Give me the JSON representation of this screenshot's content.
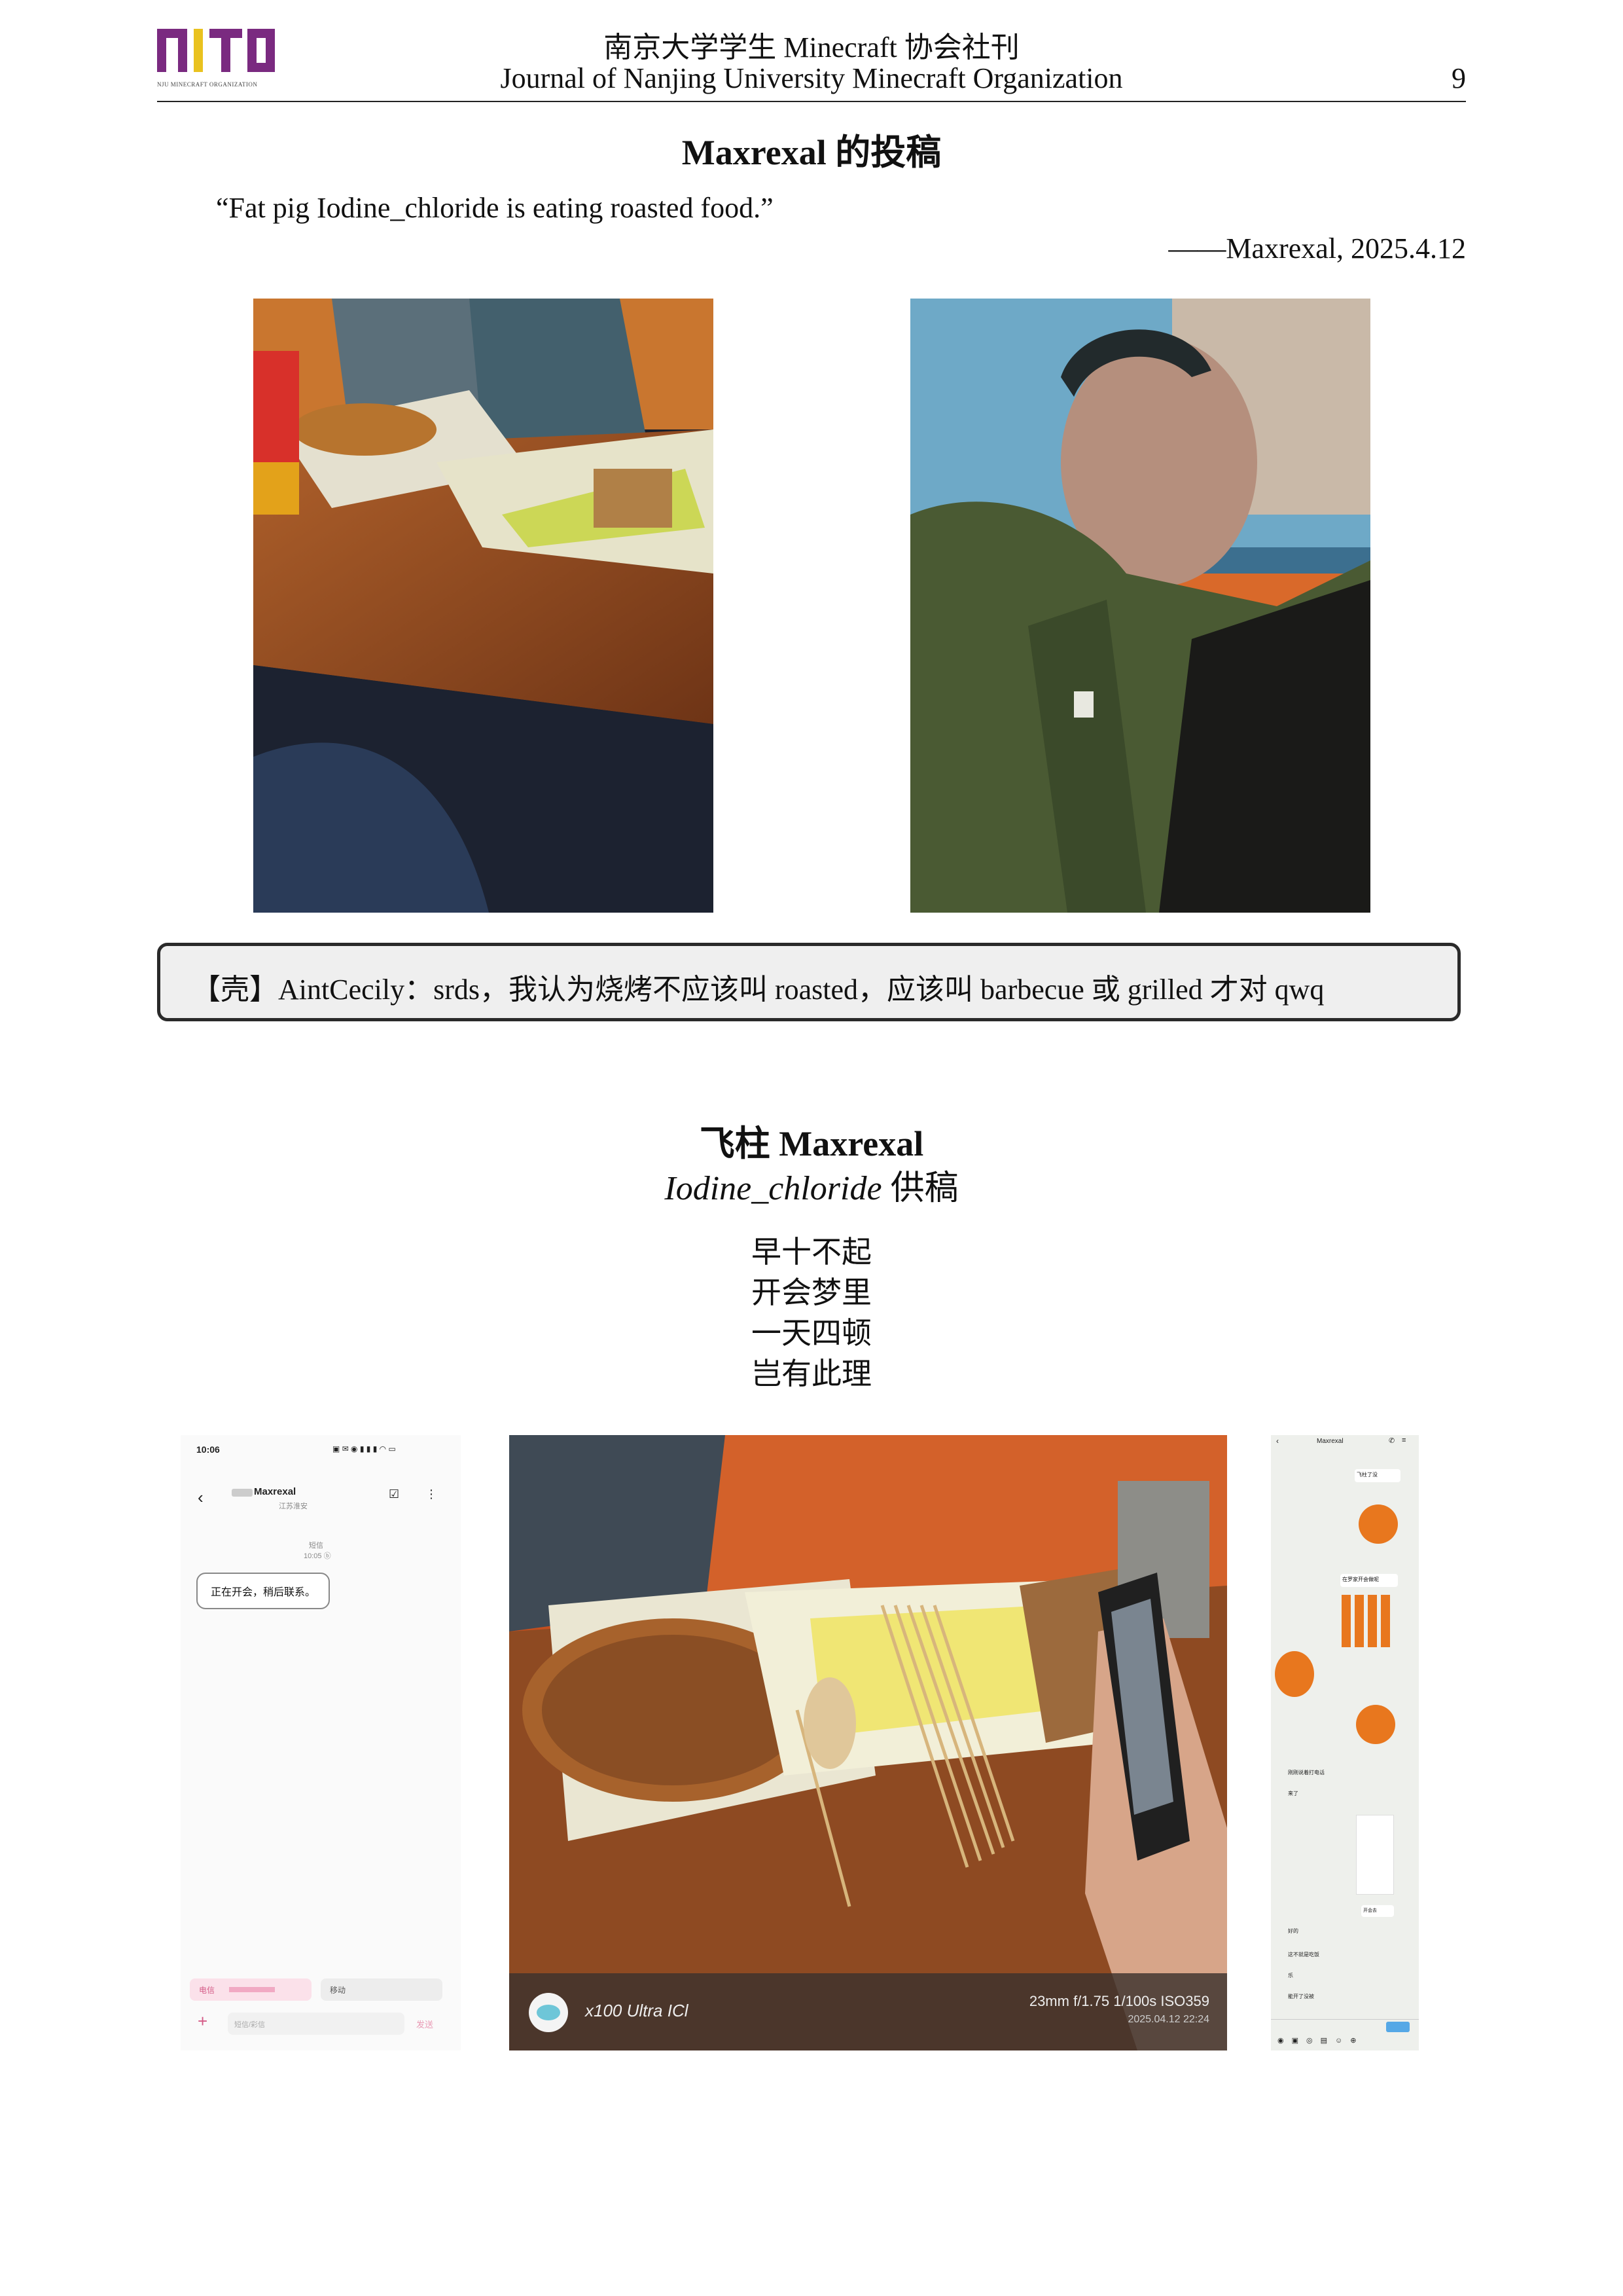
{
  "header": {
    "title_cn": "南京大学学生 Minecraft 协会社刊",
    "title_en": "Journal of Nanjing University Minecraft Organization",
    "page_number": "9",
    "logo_caption": "NJU MINECRAFT ORGANIZATION"
  },
  "article1": {
    "title": "Maxrexal 的投稿",
    "quote": "“Fat pig Iodine_chloride is eating roasted food.”",
    "signature": "——Maxrexal, 2025.4.12",
    "comment": "【壳】AintCecily：srds，我认为烧烤不应该叫 roasted，应该叫 barbecue 或 grilled 才对 qwq"
  },
  "article2": {
    "title": "飞柱 Maxrexal",
    "subtitle_italic": "Iodine_chloride",
    "subtitle_suffix": " 供稿",
    "poem": [
      "早十不起",
      "开会梦里",
      "一天四顿",
      "岂有此理"
    ]
  },
  "phone_left": {
    "time": "10:06",
    "status": "▣ ✉ ◉ ▮ ▮ ▮ ◠ ▭",
    "contact": "Maxrexal",
    "location": "江苏淮安",
    "sms_label": "短信",
    "sms_time": "10:05 ⓑ",
    "message": "正在开会，稍后联系。",
    "sim1": "电信",
    "sim2": "移动",
    "input_placeholder": "短信/彩信",
    "send": "发送"
  },
  "photo_caption": {
    "device": "x100 Ultra ICl",
    "specs": "23mm  f/1.75  1/100s  ISO359",
    "datetime": "2025.04.12 22:24"
  },
  "phone_right": {
    "contact": "Maxrexal",
    "msgs": [
      "飞柱了没",
      "在罗家开会做呢",
      "刚刚说着打电话",
      "来了",
      "好的",
      "这不就是吃饭",
      "乐",
      "能开了没被",
      "开会去"
    ]
  },
  "colors": {
    "logo_purple": "#7a2a80",
    "logo_yellow": "#e9c21f",
    "table_brown": "#8e4a22",
    "jacket_green": "#3c4a2c",
    "emoji_orange": "#e8771e"
  }
}
